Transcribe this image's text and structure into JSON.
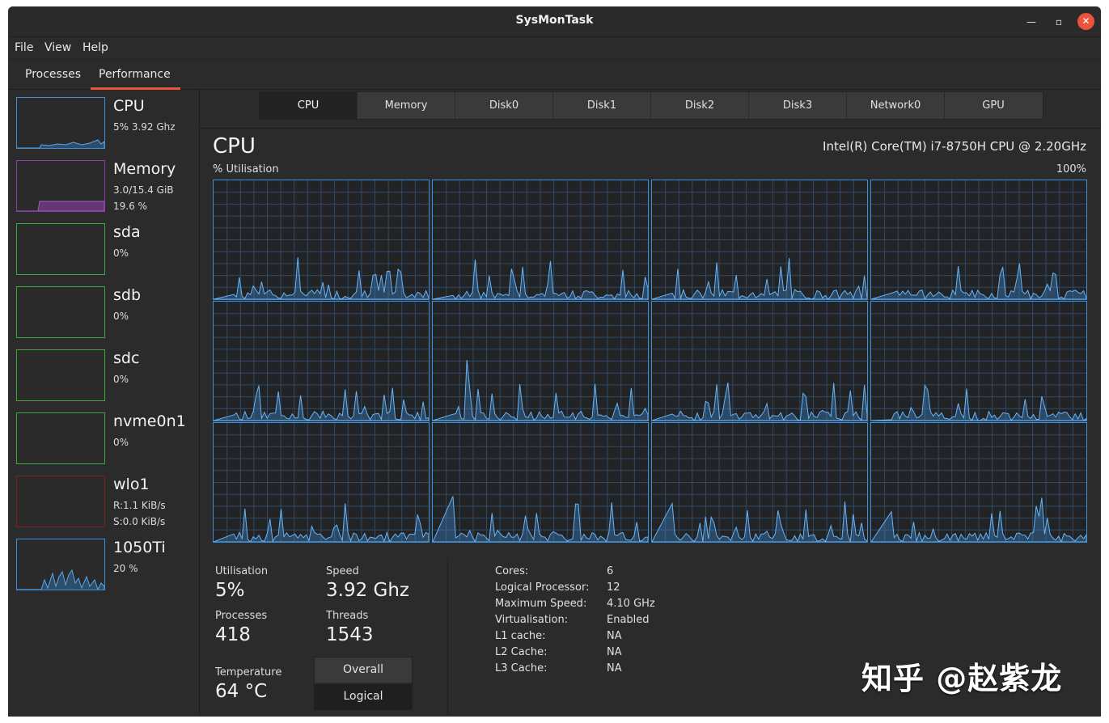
{
  "window": {
    "title": "SysMonTask"
  },
  "menu": [
    "File",
    "View",
    "Help"
  ],
  "tabs": [
    "Processes",
    "Performance"
  ],
  "sidebar": [
    {
      "name": "CPU",
      "line1": "5% 3.92 Ghz",
      "line2": "",
      "color": "#3d8fdc"
    },
    {
      "name": "Memory",
      "line1": "3.0/15.4 GiB",
      "line2": "19.6 %",
      "color": "#8a3fa8"
    },
    {
      "name": "sda",
      "line1": "0%",
      "line2": "",
      "color": "#3aa83a"
    },
    {
      "name": "sdb",
      "line1": "0%",
      "line2": "",
      "color": "#3aa83a"
    },
    {
      "name": "sdc",
      "line1": "0%",
      "line2": "",
      "color": "#3aa83a"
    },
    {
      "name": "nvme0n1",
      "line1": "0%",
      "line2": "",
      "color": "#3aa83a"
    },
    {
      "name": "wlo1",
      "line1": "R:1.1 KiB/s",
      "line2": "S:0.0 KiB/s",
      "color": "#7a2020"
    },
    {
      "name": "1050Ti",
      "line1": "20 %",
      "line2": "",
      "color": "#3d8fdc"
    }
  ],
  "devices": [
    "CPU",
    "Memory",
    "Disk0",
    "Disk1",
    "Disk2",
    "Disk3",
    "Network0",
    "GPU"
  ],
  "cpu": {
    "title": "CPU",
    "model": "Intel(R) Core(TM) i7-8750H CPU @ 2.20GHz",
    "util_label": "% Utilisation",
    "util_max": "100%",
    "cores_graph_count": 12
  },
  "stats": {
    "utilisation_label": "Utilisation",
    "utilisation": "5%",
    "speed_label": "Speed",
    "speed": "3.92 Ghz",
    "processes_label": "Processes",
    "processes": "418",
    "threads_label": "Threads",
    "threads": "1543",
    "temperature_label": "Temperature",
    "temperature": "64 °C",
    "toggle": [
      "Overall",
      "Logical"
    ]
  },
  "info": [
    {
      "key": "Cores:",
      "value": "6"
    },
    {
      "key": "Logical Processor:",
      "value": "12"
    },
    {
      "key": "Maximum Speed:",
      "value": "4.10 GHz"
    },
    {
      "key": "Virtualisation:",
      "value": "Enabled"
    },
    {
      "key": "L1 cache:",
      "value": "NA"
    },
    {
      "key": "L2 Cache:",
      "value": "NA"
    },
    {
      "key": "L3 Cache:",
      "value": "NA"
    }
  ],
  "watermark": "知乎 @赵紫龙",
  "colors": {
    "accent": "#e9543a",
    "graph_line": "#3d8fdc"
  }
}
